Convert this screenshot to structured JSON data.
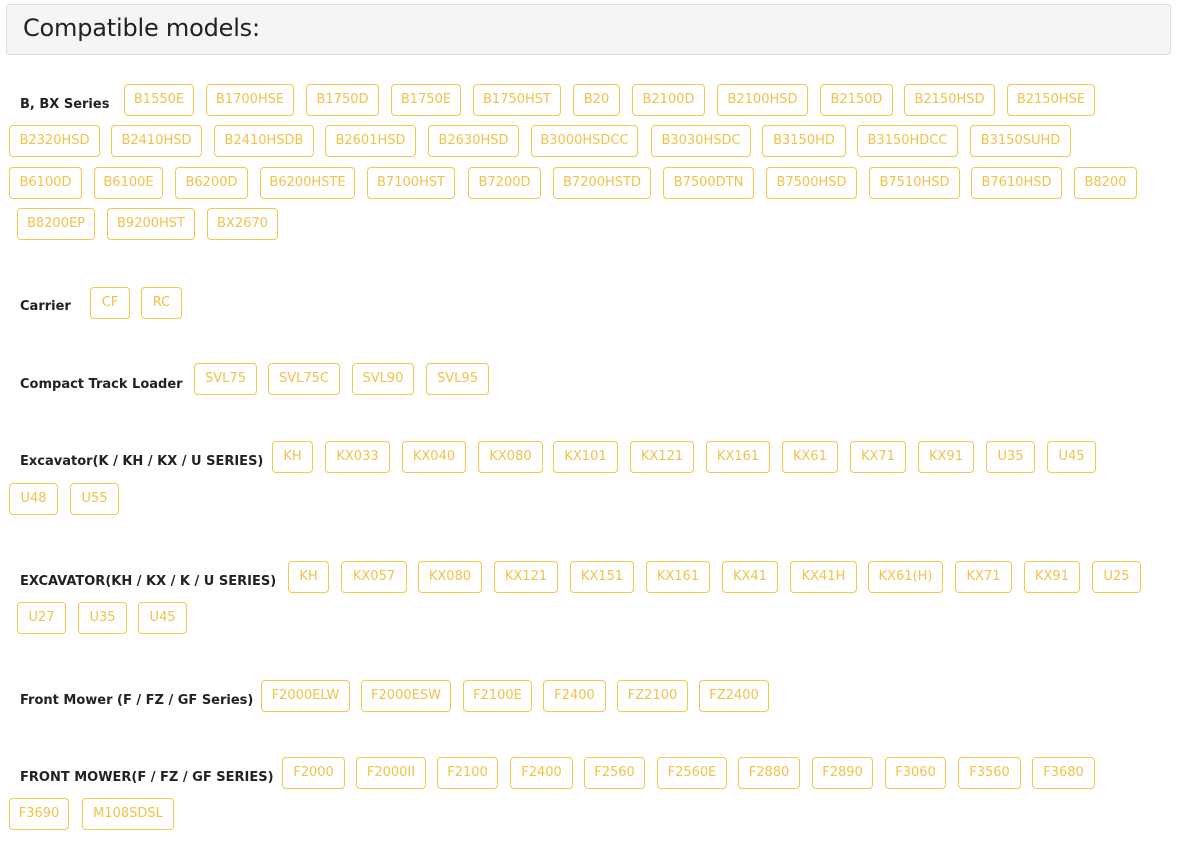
{
  "page": {
    "title": "Compatible models:",
    "accent_color": "#f2c94c"
  },
  "categories": [
    {
      "id": "b-bx-series",
      "label": "B, BX Series",
      "models": [
        "B1550E",
        "B1700HSE",
        "B1750D",
        "B1750E",
        "B1750HST",
        "B20",
        "B2100D",
        "B2100HSD",
        "B2150D",
        "B2150HSD",
        "B2150HSE",
        "B2320HSD",
        "B2410HSD",
        "B2410HSDB",
        "B2601HSD",
        "B2630HSD",
        "B3000HSDCC",
        "B3030HSDC",
        "B3150HD",
        "B3150HDCC",
        "B3150SUHD",
        "B6100D",
        "B6100E",
        "B6200D",
        "B6200HSTE",
        "B7100HST",
        "B7200D",
        "B7200HSTD",
        "B7500DTN",
        "B7500HSD",
        "B7510HSD",
        "B7610HSD",
        "B8200",
        "B8200EP",
        "B9200HST",
        "BX2670"
      ]
    },
    {
      "id": "carrier",
      "label": "Carrier",
      "models": [
        "CF",
        "RC"
      ]
    },
    {
      "id": "compact-track-loader",
      "label": "Compact Track Loader",
      "models": [
        "SVL75",
        "SVL75C",
        "SVL90",
        "SVL95"
      ]
    },
    {
      "id": "excavator-k-kh-kx-u",
      "label": "Excavator(K / KH / KX / U SERIES)",
      "models": [
        "KH",
        "KX033",
        "KX040",
        "KX080",
        "KX101",
        "KX121",
        "KX161",
        "KX61",
        "KX71",
        "KX91",
        "U35",
        "U45",
        "U48",
        "U55"
      ]
    },
    {
      "id": "excavator-kh-kx-k-u",
      "label": "EXCAVATOR(KH / KX / K / U SERIES)",
      "models": [
        "KH",
        "KX057",
        "KX080",
        "KX121",
        "KX151",
        "KX161",
        "KX41",
        "KX41H",
        "KX61(H)",
        "KX71",
        "KX91",
        "U25",
        "U27",
        "U35",
        "U45"
      ]
    },
    {
      "id": "front-mower-f-fz-gf",
      "label": "Front Mower (F / FZ / GF Series)",
      "models": [
        "F2000ELW",
        "F2000ESW",
        "F2100E",
        "F2400",
        "FZ2100",
        "FZ2400"
      ]
    },
    {
      "id": "front-mower-upper",
      "label": "FRONT MOWER(F / FZ / GF SERIES)",
      "models": [
        "F2000",
        "F2000II",
        "F2100",
        "F2400",
        "F2560",
        "F2560E",
        "F2880",
        "F2890",
        "F3060",
        "F3560",
        "F3680",
        "F3690",
        "M108SDSL"
      ]
    }
  ]
}
